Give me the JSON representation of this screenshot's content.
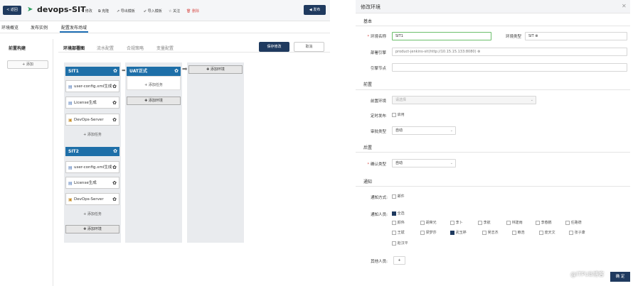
{
  "topbar": {
    "back": "< 返回",
    "title": "devops-SIT",
    "actions": [
      "修改",
      "克隆",
      "导出模板",
      "导入模板",
      "关注",
      "删除"
    ],
    "publish": "发布"
  },
  "nav": {
    "tabs": [
      "环境概览",
      "发布实例",
      "配置发布场域"
    ],
    "active": 2
  },
  "front": {
    "title": "前置构建",
    "add": "+ 添加"
  },
  "pipeline": {
    "tabs": [
      "环境部署图",
      "流水配置",
      "合规策略",
      "变量配置"
    ],
    "save": "保存修改",
    "cancel": "取消"
  },
  "envs": [
    {
      "name": "SIT1",
      "tasks": [
        "user-config.xml生成",
        "License生成",
        "DevOps-Server"
      ],
      "add_task": "+ 添加任务"
    },
    {
      "name": "SIT2",
      "tasks": [
        "user-config.xml生成",
        "License生成",
        "DevOps-Server"
      ],
      "add_task": "+ 添加任务"
    }
  ],
  "uat": {
    "name": "UAT正式",
    "add_task": "+ 添加任务",
    "add_env": "添加环境"
  },
  "add_env": "添加环境",
  "add_env2": "添加环境",
  "modal": {
    "title": "修改环境",
    "basic": "基本",
    "env_name_label": "环境名称",
    "env_name": "SIT1",
    "env_type_label": "环境类型",
    "env_type": "SIT",
    "deploy_engine_label": "部署引擎",
    "deploy_engine": "product-jenkins-sit(http://10.15.15.133:8080)",
    "engine_node_label": "引擎节点",
    "engine_node": "",
    "front_section": "前置",
    "pre_env_label": "前置环境",
    "pre_env_placeholder": "请选择",
    "schedule_label": "定时发布",
    "schedule_text": "启用",
    "approve_label": "审批类型",
    "approve_value": "自动",
    "post_section": "后置",
    "confirm_label": "确认类型",
    "confirm_value": "自动",
    "notify_section": "通知",
    "notify_method_label": "通知方式:",
    "notify_method": "邮件",
    "notify_people_label": "通知人员:",
    "all": "全选",
    "people": [
      "颜伟",
      "胡荣光",
      "李卜",
      "李航",
      "林建雨",
      "李春鹏",
      "任路德",
      "王斌",
      "梁梦莎",
      "武玉婷",
      "吴志杰",
      "赖浩",
      "庞天文",
      "张子康",
      "赵汉平"
    ],
    "people_checked": [
      "武玉婷"
    ],
    "other_label": "其他人员:",
    "other_add": "+",
    "ok": "确 定",
    "watermark": "@ITPUB博客"
  }
}
